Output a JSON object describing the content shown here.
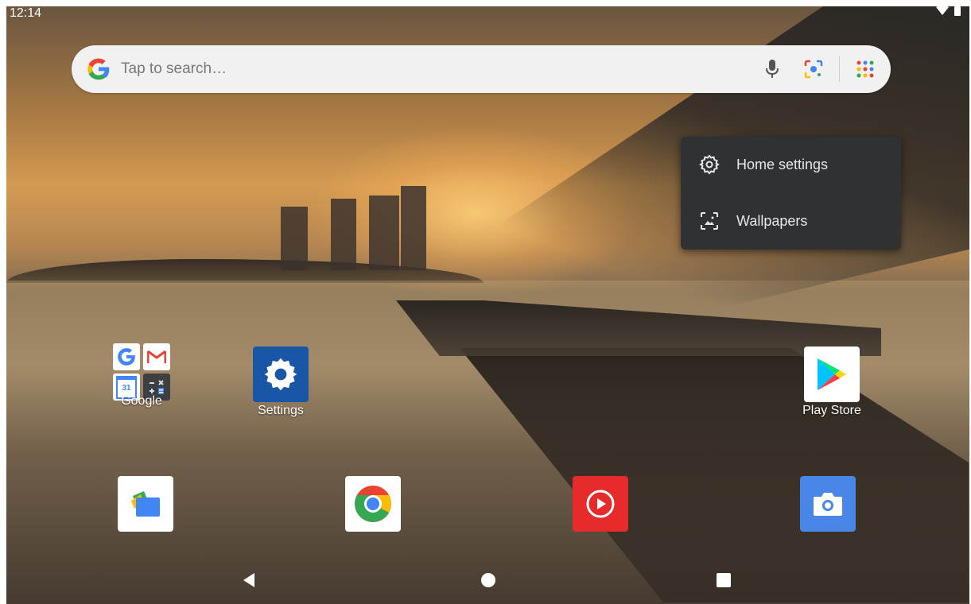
{
  "status": {
    "time": "12:14"
  },
  "search": {
    "placeholder": "Tap to search…"
  },
  "popup_menu": {
    "items": [
      {
        "label": "Home settings",
        "icon": "gear-icon"
      },
      {
        "label": "Wallpapers",
        "icon": "wallpaper-icon"
      }
    ]
  },
  "home_apps": [
    {
      "label": "Google",
      "type": "folder"
    },
    {
      "label": "Settings",
      "icon": "settings-gear-icon"
    },
    {
      "label": "Play Store",
      "icon": "play-store-icon"
    }
  ],
  "folder_mini_icons": [
    "google-go-icon",
    "gmail-icon",
    "calendar-icon",
    "calculator-icon"
  ],
  "folder_calendar_text": "31",
  "dock": [
    {
      "icon": "files-icon"
    },
    {
      "icon": "chrome-icon"
    },
    {
      "icon": "youtube-music-icon"
    },
    {
      "icon": "camera-icon"
    }
  ],
  "colors": {
    "popup_bg": "#2f3133",
    "settings_blue": "#1a56a6",
    "youtube_red": "#e52b2b",
    "camera_blue": "#4a86e8"
  }
}
